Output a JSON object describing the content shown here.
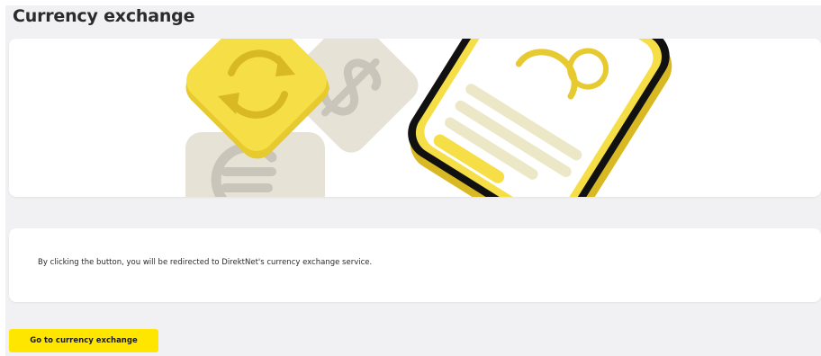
{
  "page": {
    "title": "Currency exchange"
  },
  "info": {
    "text": "By clicking the button, you will be redirected to DirektNet's currency exchange service."
  },
  "actions": {
    "primary_label": "Go to currency exchange"
  },
  "illustration": {
    "icons": [
      "exchange-arrows-icon",
      "dollar-icon",
      "euro-icon",
      "smartphone-icon",
      "user-icon"
    ]
  },
  "colors": {
    "background": "#f1f0f2",
    "card": "#ffffff",
    "accent_yellow": "#ffe600",
    "tile_yellow": "#f5de46",
    "tile_beige": "#e6e2d6",
    "symbol_grey": "#c9c5bb",
    "text": "#2b2b2b"
  }
}
